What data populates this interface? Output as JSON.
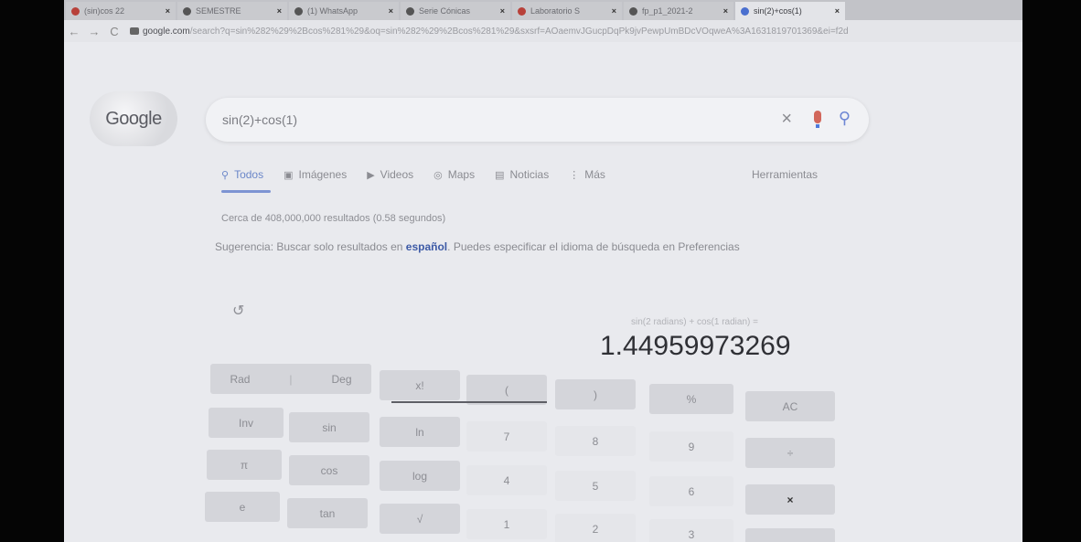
{
  "browser": {
    "tabs": [
      {
        "title": "(sin)cos 22",
        "active": false
      },
      {
        "title": "SEMESTRE",
        "active": false
      },
      {
        "title": "(1) WhatsApp",
        "active": false
      },
      {
        "title": "Serie Cónicas",
        "active": false
      },
      {
        "title": "Laboratorio S",
        "active": false
      },
      {
        "title": "fp_p1_2021-2",
        "active": false
      },
      {
        "title": "sin(2)+cos(1)",
        "active": true
      }
    ],
    "url_domain": "google.com",
    "url_rest": "/search?q=sin%282%29%2Bcos%281%29&oq=sin%282%29%2Bcos%281%29&sxsrf=AOaemvJGucpDqPk9jvPewpUmBDcVOqweA%3A1631819701369&ei=f2d"
  },
  "google": {
    "logo_text": "Google",
    "query": "sin(2)+cos(1)",
    "nav": {
      "all": "Todos",
      "images": "Imágenes",
      "videos": "Videos",
      "maps": "Maps",
      "news": "Noticias",
      "more": "Más",
      "tools": "Herramientas"
    },
    "stats": "Cerca de 408,000,000 resultados (0.58 segundos)",
    "suggestion": {
      "prefix": "Sugerencia: Buscar solo resultados en ",
      "lang": "español",
      "suffix": ". Puedes especificar el idioma de búsqueda en ",
      "link": "Preferencias"
    }
  },
  "calculator": {
    "expression": "sin(2 radians) + cos(1 radian) =",
    "result": "1.44959973269",
    "keys": {
      "rad": "Rad",
      "deg": "Deg",
      "fact": "x!",
      "lparen": "(",
      "rparen": ")",
      "percent": "%",
      "ac": "AC",
      "inv": "Inv",
      "sin": "sin",
      "ln": "ln",
      "k7": "7",
      "k8": "8",
      "k9": "9",
      "div": "÷",
      "pi": "π",
      "cos": "cos",
      "log": "log",
      "k4": "4",
      "k5": "5",
      "k6": "6",
      "mul": "×",
      "e": "e",
      "tan": "tan",
      "sqrt": "√",
      "k1": "1",
      "k2": "2",
      "k3": "3"
    }
  }
}
